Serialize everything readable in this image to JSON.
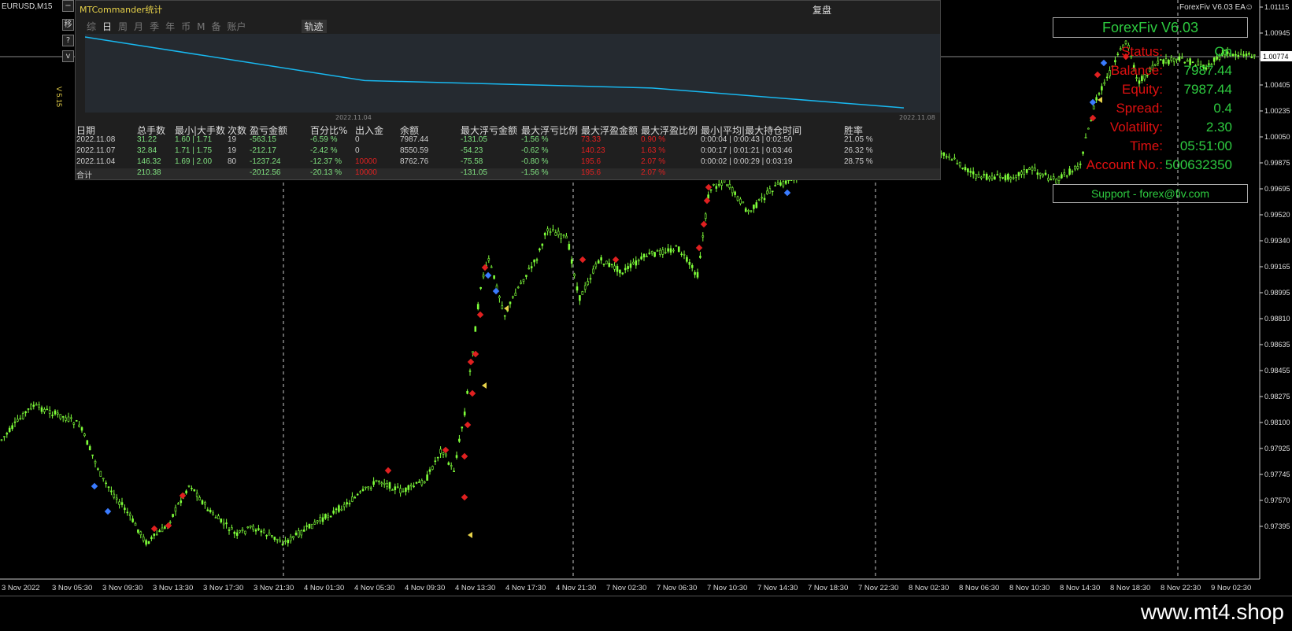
{
  "chart": {
    "symbol_label": "EURUSD,M15",
    "ea_label": "ForexFiv  V6.03 EA",
    "smiley_icon": "smiley-icon",
    "version_vertical": "V 5.15",
    "current_price": "1.00774",
    "price_ticks": [
      "1.01115",
      "1.00945",
      "1.00565",
      "1.00405",
      "1.00235",
      "1.00050",
      "0.99875",
      "0.99695",
      "0.99520",
      "0.99340",
      "0.99165",
      "0.98995",
      "0.98810",
      "0.98635",
      "0.98455",
      "0.98275",
      "0.98100",
      "0.97925",
      "0.97745",
      "0.97570",
      "0.97395"
    ],
    "time_ticks": [
      "3 Nov 2022",
      "3 Nov 05:30",
      "3 Nov 09:30",
      "3 Nov 13:30",
      "3 Nov 17:30",
      "3 Nov 21:30",
      "4 Nov 01:30",
      "4 Nov 05:30",
      "4 Nov 09:30",
      "4 Nov 13:30",
      "4 Nov 17:30",
      "4 Nov 21:30",
      "7 Nov 02:30",
      "7 Nov 06:30",
      "7 Nov 10:30",
      "7 Nov 14:30",
      "7 Nov 18:30",
      "7 Nov 22:30",
      "8 Nov 02:30",
      "8 Nov 06:30",
      "8 Nov 10:30",
      "8 Nov 14:30",
      "8 Nov 18:30",
      "8 Nov 22:30",
      "9 Nov 02:30"
    ],
    "candle_color": "#7fff3a",
    "grid_color": "#c8c8c8"
  },
  "side_buttons": {
    "move": "移",
    "hide": "隐",
    "help": "?",
    "collapse": "v"
  },
  "mtc": {
    "title": "MTCommander统计",
    "reset_label": "复盘",
    "tabs": [
      "综",
      "日",
      "周",
      "月",
      "季",
      "年",
      "币",
      "M",
      "备",
      "账户"
    ],
    "active_tab": "日",
    "track_label": "轨迹",
    "date_start": "2022.11.04",
    "date_end": "2022.11.08",
    "headers": [
      "日期",
      "总手数",
      "最小|大手数",
      "次数",
      "盈亏金额",
      "百分比%",
      "出入金",
      "余额",
      "最大浮亏金额",
      "最大浮亏比例",
      "最大浮盈金额",
      "最大浮盈比例",
      "最小|平均|最大持仓时间",
      "胜率"
    ],
    "rows": [
      [
        "2022.11.08",
        "31.22",
        "1.60 | 1.71",
        "19",
        "-563.15",
        "-6.59 %",
        "0",
        "7987.44",
        "-131.05",
        "-1.56 %",
        "73.33",
        "0.90 %",
        "0:00:04 | 0:00:43 | 0:02:50",
        "21.05 %"
      ],
      [
        "2022.11.07",
        "32.84",
        "1.71 | 1.75",
        "19",
        "-212.17",
        "-2.42 %",
        "0",
        "8550.59",
        "-54.23",
        "-0.62 %",
        "140.23",
        "1.63 %",
        "0:00:17 | 0:01:21 | 0:03:46",
        "26.32 %"
      ],
      [
        "2022.11.04",
        "146.32",
        "1.69 | 2.00",
        "80",
        "-1237.24",
        "-12.37 %",
        "10000",
        "8762.76",
        "-75.58",
        "-0.80 %",
        "195.6",
        "2.07 %",
        "0:00:02 | 0:00:29 | 0:03:19",
        "28.75 %"
      ]
    ],
    "total": [
      "合计",
      "210.38",
      "",
      "",
      "-2012.56",
      "-20.13 %",
      "10000",
      "",
      "-131.05",
      "-1.56 %",
      "195.6",
      "2.07 %",
      "",
      ""
    ],
    "equity_curve": [
      10000,
      8762.76,
      8550.59,
      7987.44
    ]
  },
  "forexfiv": {
    "title": "ForexFiv  V6.03",
    "rows": [
      {
        "key": "Status:",
        "value": "On"
      },
      {
        "key": "Balance:",
        "value": "7987.44"
      },
      {
        "key": "Equity:",
        "value": "7987.44"
      },
      {
        "key": "Spread:",
        "value": "0.4"
      },
      {
        "key": "Volatility:",
        "value": "2.30"
      },
      {
        "key": "Time:",
        "value": "05:51:00"
      },
      {
        "key": "Account No.:",
        "value": "500632350"
      }
    ],
    "support": "Support - forex@fiv.com"
  },
  "watermark": "www.mt4.shop"
}
